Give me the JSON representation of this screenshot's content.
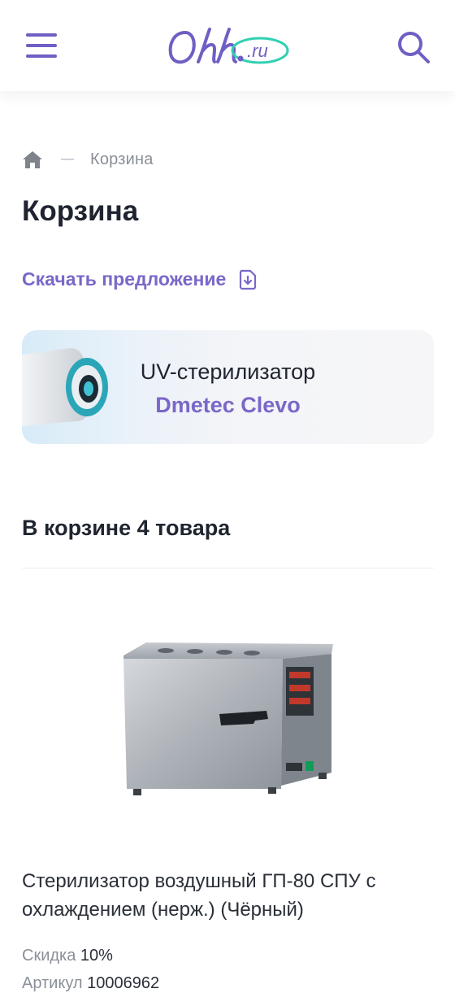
{
  "header": {
    "menu_icon": "hamburger-menu-icon",
    "logo_text": "Ohh",
    "logo_domain": ".ru",
    "search_icon": "search-icon",
    "brand_color": "#6f5fc4",
    "accent_color": "#2fd0b2"
  },
  "breadcrumb": {
    "home_icon": "home-icon",
    "current": "Корзина"
  },
  "page": {
    "title": "Корзина"
  },
  "download": {
    "label": "Скачать предложение",
    "icon": "download-document-icon"
  },
  "promo": {
    "line1": "UV-стерилизатор",
    "line2": "Dmetec Clevo"
  },
  "cart": {
    "count_text": "В корзине 4 товара"
  },
  "product": {
    "name": "Стерилизатор воздушный ГП-80 СПУ с охлаждением (нерж.) (Чёрный)",
    "discount_label": "Скидка",
    "discount_value": "10%",
    "sku_label": "Артикул",
    "sku_value": "10006962"
  }
}
